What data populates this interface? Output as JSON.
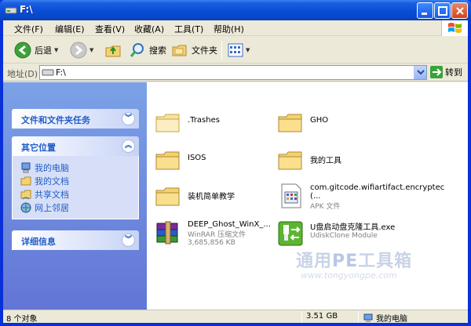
{
  "window": {
    "title": "F:\\"
  },
  "menu": [
    "文件(F)",
    "编辑(E)",
    "查看(V)",
    "收藏(A)",
    "工具(T)",
    "帮助(H)"
  ],
  "toolbar": {
    "back": "后退",
    "search": "搜索",
    "folders": "文件夹"
  },
  "address": {
    "label": "地址(D)",
    "value": "F:\\",
    "go": "转到"
  },
  "taskpane": {
    "tasks_title": "文件和文件夹任务",
    "other_title": "其它位置",
    "other_links": [
      "我的电脑",
      "我的文档",
      "共享文档",
      "网上邻居"
    ],
    "details_title": "详细信息"
  },
  "files": [
    {
      "name": ".Trashes",
      "type": "folder"
    },
    {
      "name": "GHO",
      "type": "folder"
    },
    {
      "name": "ISOS",
      "type": "folder"
    },
    {
      "name": "我的工具",
      "type": "folder"
    },
    {
      "name": "装机简单教学",
      "type": "folder"
    },
    {
      "name": "com.gitcode.wifiartifact.encryptec (...",
      "sub": "APK 文件",
      "type": "apk"
    },
    {
      "name": "DEEP_Ghost_WinX_...",
      "sub": "WinRAR 压缩文件",
      "sub2": "3,685,856 KB",
      "type": "rar"
    },
    {
      "name": "U盘启动盘克隆工具.exe",
      "sub": "UdiskClone Module",
      "type": "exe"
    }
  ],
  "watermark": {
    "main_a": "通用",
    "main_pe": "PE",
    "main_b": "工具箱",
    "url": "www.tongyongpe.com"
  },
  "status": {
    "count": "8 个对象",
    "size": "3.51 GB",
    "location": "我的电脑"
  },
  "colors": {
    "title_blue": "#0a4fd8",
    "pane_blue": "#6375d6",
    "link_blue": "#215dc6",
    "folder_yellow": "#f4d271"
  }
}
